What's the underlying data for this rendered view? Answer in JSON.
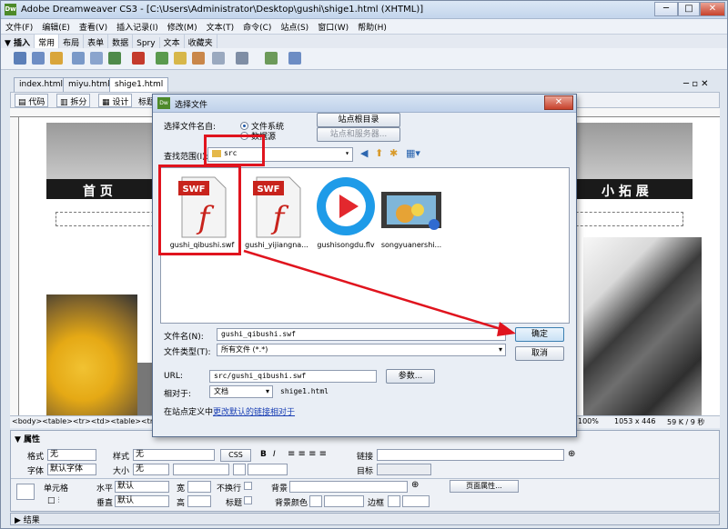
{
  "window": {
    "title": "Adobe Dreamweaver CS3 - [C:\\Users\\Administrator\\Desktop\\gushi\\shige1.html (XHTML)]",
    "logo": "Dw",
    "minimize": "─",
    "maximize": "□",
    "close": "✕"
  },
  "menu": [
    "文件(F)",
    "编辑(E)",
    "查看(V)",
    "插入记录(I)",
    "修改(M)",
    "文本(T)",
    "命令(C)",
    "站点(S)",
    "窗口(W)",
    "帮助(H)"
  ],
  "insert_bar": {
    "label": "▼ 插入",
    "tabs": [
      "常用",
      "布局",
      "表单",
      "数据",
      "Spry",
      "文本",
      "收藏夹"
    ]
  },
  "doc_tabs": [
    "index.html",
    "miyu.html",
    "shige1.html"
  ],
  "view_buttons": {
    "code": "代码",
    "split": "拆分",
    "design": "设计",
    "title_label": "标题"
  },
  "page": {
    "nav_left": "首 页",
    "nav_right": "小 拓 展"
  },
  "status": {
    "tag_path": "<body><table><tr><td><table><tr>",
    "zoom": "100%",
    "size": "1053 x 446",
    "file_info": "59 K / 9 秒"
  },
  "properties": {
    "header": "▼ 属性",
    "format_label": "格式",
    "format_value": "无",
    "style_label": "样式",
    "style_value": "无",
    "css_button": "CSS",
    "bold": "B",
    "italic": "I",
    "link_label": "链接",
    "target_label": "目标",
    "font_label": "字体",
    "font_value": "默认字体",
    "size_label": "大小",
    "size_value": "无",
    "cell_label": "单元格",
    "horz_label": "水平",
    "horz_value": "默认",
    "vert_label": "垂直",
    "vert_value": "默认",
    "width_label": "宽",
    "height_label": "高",
    "nowrap_label": "不换行",
    "header_label": "标题",
    "bg_label": "背景",
    "bgcolor_label": "背景颜色",
    "border_label": "边框",
    "page_props_button": "页面属性..."
  },
  "results_label": "▶ 结果",
  "dialog": {
    "title": "选择文件",
    "select_from_label": "选择文件名自:",
    "radio_filesystem": "文件系统",
    "radio_datasource": "数据源",
    "site_root_button": "站点根目录",
    "site_server_button": "站点和服务器...",
    "lookin_label": "查找范围(I):",
    "lookin_value": "src",
    "files": [
      {
        "name": "gushi_qibushi.swf",
        "icon": "swf-file-icon",
        "badge": "SWF"
      },
      {
        "name": "gushi_yijiangna...",
        "icon": "swf-file-icon",
        "badge": "SWF"
      },
      {
        "name": "gushisongdu.flv",
        "icon": "flv-player-icon"
      },
      {
        "name": "songyuanershi...",
        "icon": "video-thumbnail-icon"
      }
    ],
    "filename_label": "文件名(N):",
    "filename_value": "gushi_qibushi.swf",
    "filetype_label": "文件类型(T):",
    "filetype_value": "所有文件 (*.*)",
    "ok_button": "确定",
    "cancel_button": "取消",
    "url_label": "URL:",
    "url_value": "src/gushi_qibushi.swf",
    "params_button": "参数...",
    "relative_label": "相对于:",
    "relative_value": "文档",
    "relative_file": "shige1.html",
    "site_def_prefix": "在站点定义中",
    "site_def_link": "更改默认的链接相对于",
    "close": "✕"
  },
  "colors": {
    "highlight_red": "#e0141e",
    "link_blue": "#1a3fb4",
    "nav_black": "#1a1a1a"
  }
}
